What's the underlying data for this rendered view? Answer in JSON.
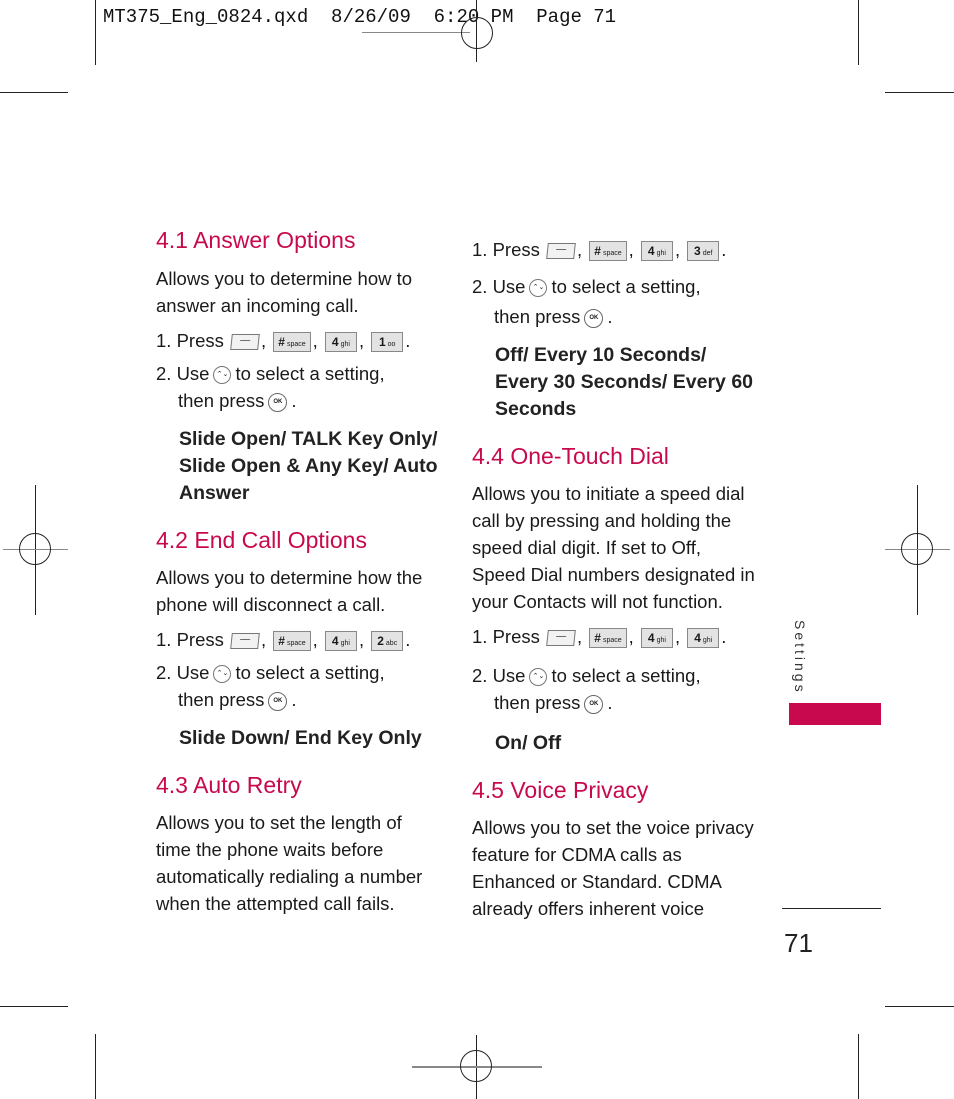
{
  "slug": "MT375_Eng_0824.qxd  8/26/09  6:20 PM  Page 71",
  "accent_color": "#c8094d",
  "left_column": {
    "sections": [
      {
        "heading": "4.1 Answer Options",
        "description": "Allows you to determine how to answer an incoming call.",
        "step1_prefix": "1. Press",
        "keys": [
          "#",
          "4",
          "1"
        ],
        "key_subs": [
          "space",
          "ghi",
          "voicemail"
        ],
        "step2_a": "2. Use",
        "step2_b": "to select a setting,",
        "step2_c": "then press",
        "options": "Slide Open/ TALK Key Only/ Slide Open & Any Key/ Auto Answer"
      },
      {
        "heading": "4.2 End Call Options",
        "description": "Allows you to determine how the phone will disconnect a call.",
        "step1_prefix": "1. Press",
        "keys": [
          "#",
          "4",
          "2"
        ],
        "key_subs": [
          "space",
          "ghi",
          "abc"
        ],
        "step2_a": "2. Use",
        "step2_b": "to select a setting,",
        "step2_c": "then press",
        "options": "Slide Down/ End Key Only"
      },
      {
        "heading": "4.3 Auto Retry",
        "description": "Allows you to set the length of time the phone waits before automatically redialing a number when the attempted call fails."
      }
    ]
  },
  "right_column": {
    "sections": [
      {
        "step1_prefix": "1. Press",
        "keys": [
          "#",
          "4",
          "3"
        ],
        "key_subs": [
          "space",
          "ghi",
          "def"
        ],
        "step2_a": "2. Use",
        "step2_b": "to select a setting,",
        "step2_c": "then press",
        "options": "Off/ Every 10 Seconds/ Every 30 Seconds/ Every 60 Seconds"
      },
      {
        "heading": "4.4 One-Touch Dial",
        "description": "Allows you to initiate a speed dial call by pressing and holding the speed dial digit. If set to Off, Speed Dial numbers designated in your Contacts will not function.",
        "step1_prefix": "1. Press",
        "keys": [
          "#",
          "4",
          "4"
        ],
        "key_subs": [
          "space",
          "ghi",
          "ghi"
        ],
        "step2_a": "2. Use",
        "step2_b": "to select a setting,",
        "step2_c": "then press",
        "options": "On/ Off"
      },
      {
        "heading": "4.5 Voice Privacy",
        "description": "Allows you to set the voice privacy feature for CDMA calls as Enhanced or Standard. CDMA already offers inherent voice"
      }
    ]
  },
  "icons": {
    "soft_key": "soft-key-icon",
    "nav_key": "navigation-key-icon",
    "ok_key": "ok-key-icon",
    "ok_label": "OK",
    "soft_label": "—",
    "nav_label": "⌃⌄"
  },
  "sidebar": {
    "label": "Settings"
  },
  "page_number": "71"
}
